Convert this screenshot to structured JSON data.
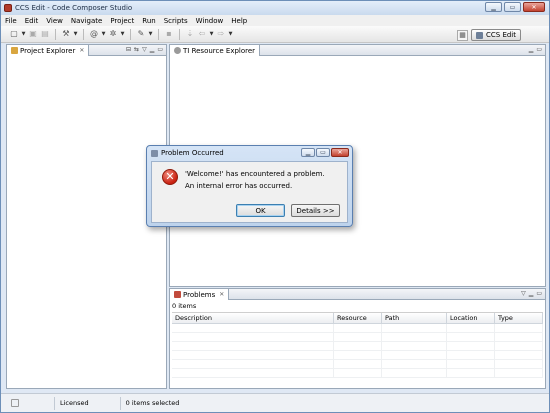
{
  "window": {
    "title": "CCS Edit - Code Composer Studio"
  },
  "menu": [
    "File",
    "Edit",
    "View",
    "Navigate",
    "Project",
    "Run",
    "Scripts",
    "Window",
    "Help"
  ],
  "perspective": {
    "label": "CCS Edit"
  },
  "project_explorer": {
    "tab_label": "Project Explorer"
  },
  "resource_explorer": {
    "tab_label": "TI Resource Explorer"
  },
  "problems": {
    "tab_label": "Problems",
    "count": "0 items",
    "columns": [
      "Description",
      "Resource",
      "Path",
      "Location",
      "Type"
    ]
  },
  "status": {
    "license": "Licensed",
    "selection": "0 items selected"
  },
  "dialog": {
    "title": "Problem Occurred",
    "message": "'Welcome!' has encountered a problem.",
    "detail": "An internal error has occurred.",
    "ok_label": "OK",
    "details_label": "Details >>"
  },
  "colors": {
    "accent": "#3c7fb1",
    "error": "#c92010",
    "titlebar": "#c9daee"
  }
}
